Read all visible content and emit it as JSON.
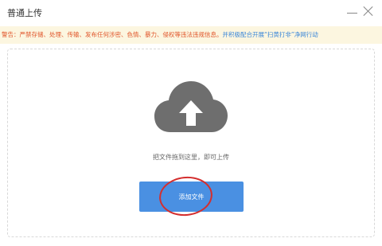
{
  "dialog": {
    "title": "普通上传",
    "minimize_icon": "minimize-icon",
    "close_icon": "close-icon"
  },
  "warning": {
    "text": "警告：严禁存储、处理、传输、发布任何涉密、色情、暴力、侵权等违法违规信息。",
    "link_text": "并积极配合开展“扫黄打非”净网行动",
    "text_color": "#e0552a",
    "link_color": "#3a86d8",
    "background": "#fcf6e0"
  },
  "upload": {
    "icon": "cloud-upload-icon",
    "hint": "把文件拖到这里，即可上传",
    "button_label": "添加文件",
    "button_color": "#4a90e2",
    "annotation_color": "#d42e2e"
  }
}
